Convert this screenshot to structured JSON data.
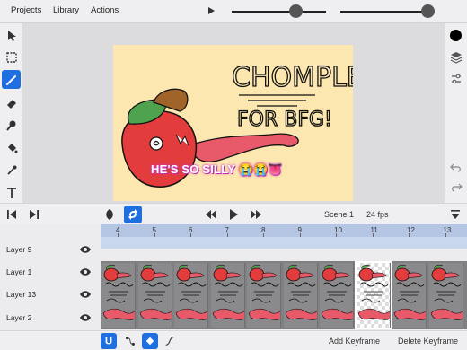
{
  "menu": {
    "projects": "Projects",
    "library": "Library",
    "actions": "Actions"
  },
  "sliders": {
    "brush_size_level": 0.72,
    "opacity_level": 0.92
  },
  "canvas": {
    "title_line1": "CHOMPLE",
    "title_line2": "FOR BFG!",
    "caption": "HE'S SO SILLY 😭😭👅",
    "background": "#fde7b0"
  },
  "playback": {
    "scene": "Scene 1",
    "fps": "24 fps"
  },
  "timeline": {
    "ticks": [
      "4",
      "5",
      "6",
      "7",
      "8",
      "9",
      "10",
      "11",
      "12",
      "13"
    ],
    "layers": [
      {
        "name": "Layer 9"
      },
      {
        "name": "Layer 1"
      },
      {
        "name": "Layer 13"
      },
      {
        "name": "Layer 2"
      }
    ],
    "current_frame": "11"
  },
  "bottom": {
    "add_keyframe": "Add Keyframe",
    "delete_keyframe": "Delete Keyframe"
  },
  "colors": {
    "accent": "#1f6fe0",
    "current_color": "#000000",
    "caption_glow": "#d23cc4",
    "ruler": "#b4c6e3"
  },
  "icons": [
    "select-arrow-icon",
    "marquee-icon",
    "brush-icon",
    "eraser-icon",
    "smudge-icon",
    "fill-bucket-icon",
    "eyedropper-icon",
    "text-icon",
    "layers-icon",
    "adjustments-icon",
    "undo-icon",
    "redo-icon",
    "onion-skin-icon",
    "loop-icon",
    "rewind-icon",
    "play-icon",
    "fast-forward-icon"
  ]
}
